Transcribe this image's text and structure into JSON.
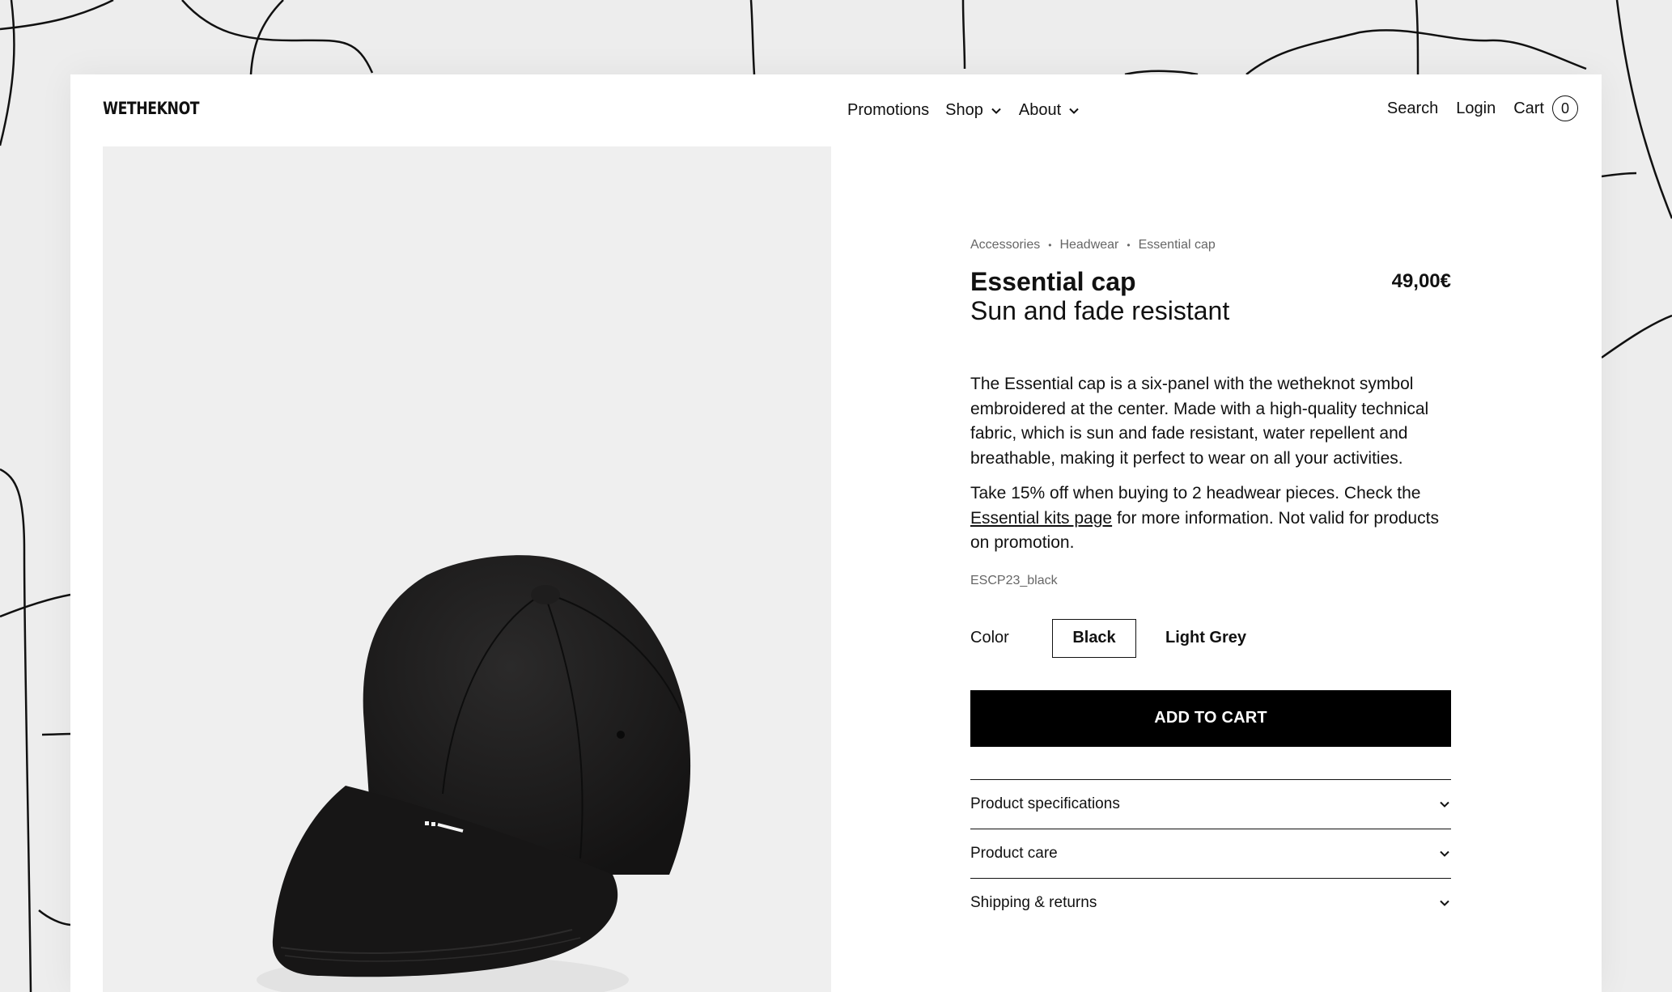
{
  "header": {
    "logo": "WETHEKNOT",
    "nav": [
      {
        "label": "Promotions"
      },
      {
        "label": "Shop"
      },
      {
        "label": "About"
      }
    ],
    "search_label": "Search",
    "login_label": "Login",
    "cart_label": "Cart",
    "cart_count": "0"
  },
  "product": {
    "breadcrumb": [
      "Accessories",
      "Headwear",
      "Essential cap"
    ],
    "title": "Essential cap",
    "subtitle": "Sun and fade resistant",
    "price": "49,00€",
    "description_1": "The Essential cap is a six-panel with the wetheknot symbol embroidered at the center. Made with a high-quality technical fabric, which is sun and fade resistant, water repellent and breathable, making it perfect to wear on all your activities.",
    "description_2_before": "Take 15% off when buying to 2 headwear pieces. Check the ",
    "description_2_link": "Essential kits page",
    "description_2_after": " for more information. Not valid for products on promotion.",
    "sku": "ESCP23_black",
    "color_label": "Color",
    "colors": [
      {
        "label": "Black",
        "selected": true
      },
      {
        "label": "Light Grey",
        "selected": false
      }
    ],
    "add_to_cart_label": "ADD TO CART",
    "accordion": [
      {
        "label": "Product specifications"
      },
      {
        "label": "Product care"
      },
      {
        "label": "Shipping & returns"
      }
    ]
  },
  "colors": {
    "background": "#ededed",
    "panel": "#ffffff",
    "image_bg": "#efefef",
    "button_bg": "#000000",
    "text": "#111111",
    "muted": "#666666"
  }
}
